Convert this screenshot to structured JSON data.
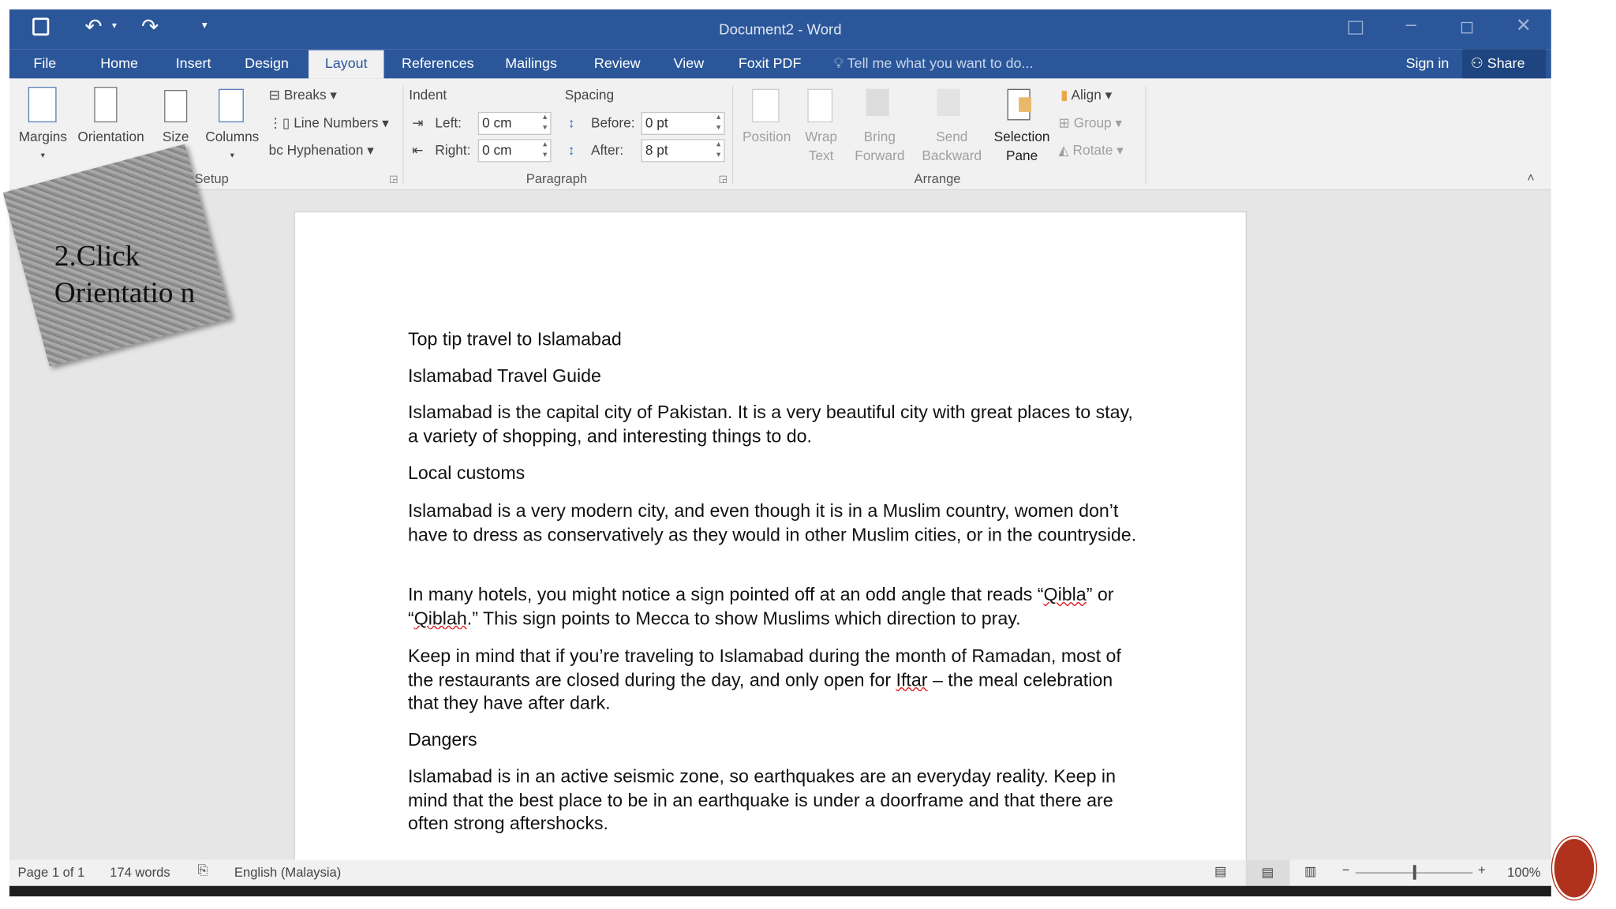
{
  "window": {
    "title": "Document2 - Word"
  },
  "quick_access": {
    "save": "save-icon",
    "undo": "undo-icon",
    "redo": "redo-icon",
    "customize": "customize-icon"
  },
  "tabs": [
    "File",
    "Home",
    "Insert",
    "Design",
    "Layout",
    "References",
    "Mailings",
    "Review",
    "View",
    "Foxit PDF"
  ],
  "active_tab": "Layout",
  "tell_me": "Tell me what you want to do...",
  "sign_in": "Sign in",
  "share": "Share",
  "ribbon": {
    "setup": {
      "label": "Setup",
      "margins": "Margins",
      "orientation": "Orientation",
      "size": "Size",
      "columns": "Columns",
      "breaks": "Breaks",
      "line_numbers": "Line Numbers",
      "hyphenation": "Hyphenation"
    },
    "paragraph": {
      "label": "Paragraph",
      "indent": "Indent",
      "spacing": "Spacing",
      "left": "Left:",
      "right": "Right:",
      "left_val": "0 cm",
      "right_val": "0 cm",
      "before": "Before:",
      "after": "After:",
      "before_val": "0 pt",
      "after_val": "8 pt"
    },
    "arrange": {
      "label": "Arrange",
      "position": "Position",
      "wrap1": "Wrap",
      "wrap2": "Text",
      "bring1": "Bring",
      "bring2": "Forward",
      "send1": "Send",
      "send2": "Backward",
      "sel1": "Selection",
      "sel2": "Pane",
      "align": "Align",
      "group": "Group",
      "rotate": "Rotate"
    }
  },
  "callout": {
    "text": "2.Click Orientatio n"
  },
  "document": {
    "paragraphs": [
      "Top tip travel to Islamabad",
      "Islamabad Travel Guide",
      "Islamabad is the capital city of Pakistan. It is a very beautiful city with great places to stay, a variety of shopping, and interesting things to do.",
      "Local customs",
      "Islamabad is a very modern city, and even though it is in a Muslim country, women don’t have to dress as conservatively as they would in other Muslim cities, or in the countryside.",
      {
        "a": "In many hotels, you might notice a sign pointed off at an odd angle that reads “",
        "b": "Qibla",
        "c": "” or “",
        "d": "Qiblah",
        "e": ".” This sign points to Mecca to show Muslims which direction to pray."
      },
      {
        "a": "Keep in mind that if you’re traveling to Islamabad during the month of Ramadan, most of the restaurants are closed during the day, and only open for ",
        "b": "Iftar",
        "c": " – the meal celebration that they have after dark."
      },
      "Dangers",
      "Islamabad is in an active seismic zone, so earthquakes are an everyday reality. Keep in mind that the best place to be in an earthquake is under a doorframe and that there are often strong aftershocks."
    ]
  },
  "status": {
    "page": "Page 1 of 1",
    "words": "174 words",
    "language": "English (Malaysia)",
    "zoom": "100%",
    "zoom_level": 100
  },
  "colors": {
    "brand": "#2b579a",
    "ribbon": "#f1f1f1"
  }
}
